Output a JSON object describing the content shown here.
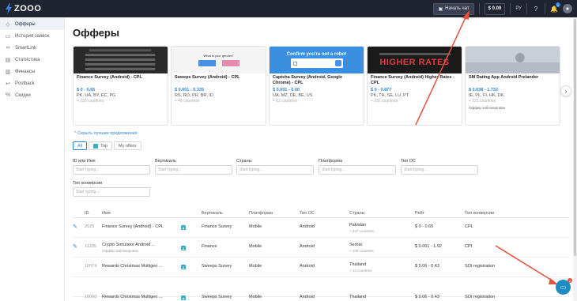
{
  "topbar": {
    "logo_text": "ZOOO",
    "chat_button": "Начать чат",
    "balance": "$ 0.00",
    "language": "РУ",
    "notifications_count": "1"
  },
  "sidebar": {
    "items": [
      {
        "label": "Офферы",
        "icon": "tag-icon",
        "active": true
      },
      {
        "label": "История заявок",
        "icon": "doc-icon",
        "active": false
      },
      {
        "label": "SmartLink",
        "icon": "link-icon",
        "active": false
      },
      {
        "label": "Статистика",
        "icon": "chart-icon",
        "active": false
      },
      {
        "label": "Финансы",
        "icon": "wallet-icon",
        "active": false
      },
      {
        "label": "Postback",
        "icon": "postback-icon",
        "active": false
      },
      {
        "label": "Скидки",
        "icon": "discount-icon",
        "active": false
      }
    ]
  },
  "main": {
    "title": "Офферы",
    "hide_recommended": "Скрыть лучшие предложения",
    "tabs": [
      {
        "label": "All",
        "active": true
      },
      {
        "label": "Top",
        "active": false
      },
      {
        "label": "My offers",
        "active": false
      }
    ]
  },
  "cards": [
    {
      "name": "Finance Survey (Android) - CPL",
      "payout": "$ 0 - 0.65",
      "countries": "PK, UA, BY, EC, PG",
      "more": "+ 233 countries",
      "badge": "",
      "thumb_bg": "#2a2a2a",
      "thumb_text": ""
    },
    {
      "name": "Sweeps Survey (Android) - CPL",
      "payout": "$ 0.001 - 0.335",
      "countries": "RS, RO, PH, BR, ID",
      "more": "+ 46 countries",
      "badge": "",
      "thumb_bg": "#f4f4f4",
      "thumb_text": "What is your gender?"
    },
    {
      "name": "Captcha Survey (Android, Google Chrome) - CPL",
      "payout": "$ 0.001 - 0.00",
      "countries": "UA, MZ, DE, BE, US",
      "more": "+ 62 countries",
      "badge": "",
      "thumb_bg": "#3a8fe0",
      "thumb_text": "Confirm you're not a robot"
    },
    {
      "name": "Finance Survey (Android) Higher Rates - CPL",
      "payout": "$ 0 - 0.877",
      "countries": "PK, TH, SE, LU, PT",
      "more": "+ 232 countries",
      "badge": "",
      "thumb_bg": "#1b1b1b",
      "thumb_text": "HIGHER RATES"
    },
    {
      "name": "SM Dating App Android Prelander",
      "payout": "$ 0.038 - 1.732",
      "countries": "IE, PL, FI, HK, DK",
      "more": "+ 221 countries",
      "badge": "Оффер заблокирован",
      "thumb_bg": "#cfd5dc",
      "thumb_text": ""
    }
  ],
  "filters": [
    {
      "label": "ID или Имя",
      "placeholder": "Start typing..."
    },
    {
      "label": "Вертикаль",
      "placeholder": "Start typing..."
    },
    {
      "label": "Страны",
      "placeholder": "Start typing..."
    },
    {
      "label": "Платформа",
      "placeholder": "Start typing..."
    },
    {
      "label": "Тип ОС",
      "placeholder": "Start typing..."
    },
    {
      "label": "Тип конверсии",
      "placeholder": "Start typing..."
    }
  ],
  "table": {
    "headers": [
      "ID",
      "Имя",
      "Вертикаль",
      "Платформа",
      "Тип ОС",
      "Страны",
      "Рейт",
      "Тип конверсии"
    ],
    "rows": [
      {
        "id": "2025",
        "name": "Finance Survey (Android) - CPL",
        "name_sub": "",
        "vertical": "Finance Survey",
        "platform": "Mobile",
        "os": "Android",
        "country": "Pakistan",
        "country_sub": "+ 237 countries",
        "rate": "$ 0 - 0.65",
        "conversion": "CPL",
        "pinned": true
      },
      {
        "id": "11205",
        "name": "Crypto Simulator Android ...",
        "name_sub": "Оффер заблокирован",
        "vertical": "Finance",
        "platform": "Mobile",
        "os": "Android",
        "country": "Serbia",
        "country_sub": "+ 109 countries",
        "rate": "$ 0.001 - 1.92",
        "conversion": "CPI",
        "pinned": true
      },
      {
        "id": "10074",
        "name": "Rewards Christmas Multigeo ...",
        "name_sub": "",
        "vertical": "Sweeps Survey",
        "platform": "Mobile",
        "os": "Android",
        "country": "Thailand",
        "country_sub": "+ 13 countries",
        "rate": "$ 0.06 - 0.43",
        "conversion": "SOI registration",
        "pinned": false
      },
      {
        "id": "10060",
        "name": "Rewards Christmas Multigeo ...",
        "name_sub": "",
        "vertical": "Sweeps Survey",
        "platform": "Mobile",
        "os": "Android",
        "country": "Thailand",
        "country_sub": "",
        "rate": "$ 0.06 - 0.43",
        "conversion": "SOI registration",
        "pinned": false
      }
    ]
  },
  "chat_fab_count": "2",
  "colors": {
    "topbar": "#1f2430",
    "accent": "#2b83d8",
    "annotation_arrow": "#e0533e"
  }
}
